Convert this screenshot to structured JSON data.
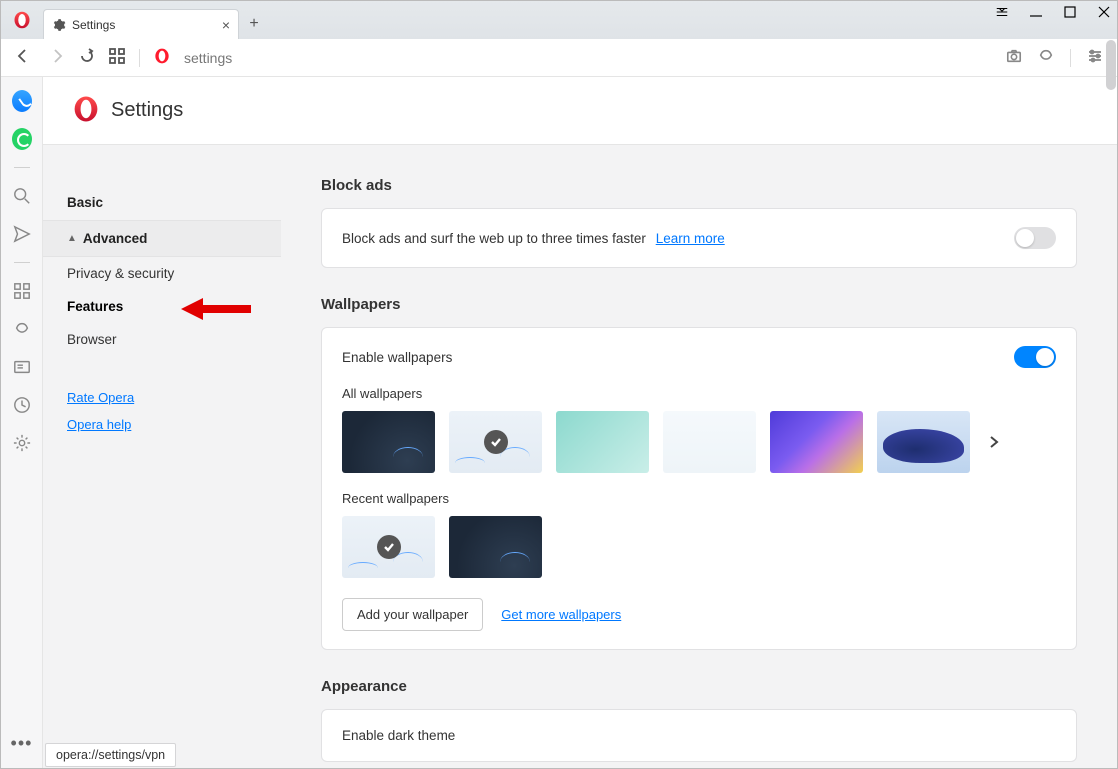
{
  "tab": {
    "title": "Settings"
  },
  "toolbar": {
    "address": "settings"
  },
  "page_header": {
    "title": "Settings"
  },
  "sidebar": {
    "basic": "Basic",
    "advanced": "Advanced",
    "subs": [
      "Privacy & security",
      "Features",
      "Browser"
    ],
    "rate": "Rate Opera",
    "help": "Opera help"
  },
  "block_ads": {
    "heading": "Block ads",
    "text": "Block ads and surf the web up to three times faster",
    "learn": "Learn more",
    "enabled": false
  },
  "wallpapers": {
    "heading": "Wallpapers",
    "enable_label": "Enable wallpapers",
    "enabled": true,
    "all_label": "All wallpapers",
    "recent_label": "Recent wallpapers",
    "add_btn": "Add your wallpaper",
    "get_more": "Get more wallpapers"
  },
  "appearance": {
    "heading": "Appearance",
    "dark": "Enable dark theme"
  },
  "status_bar": "opera://settings/vpn"
}
